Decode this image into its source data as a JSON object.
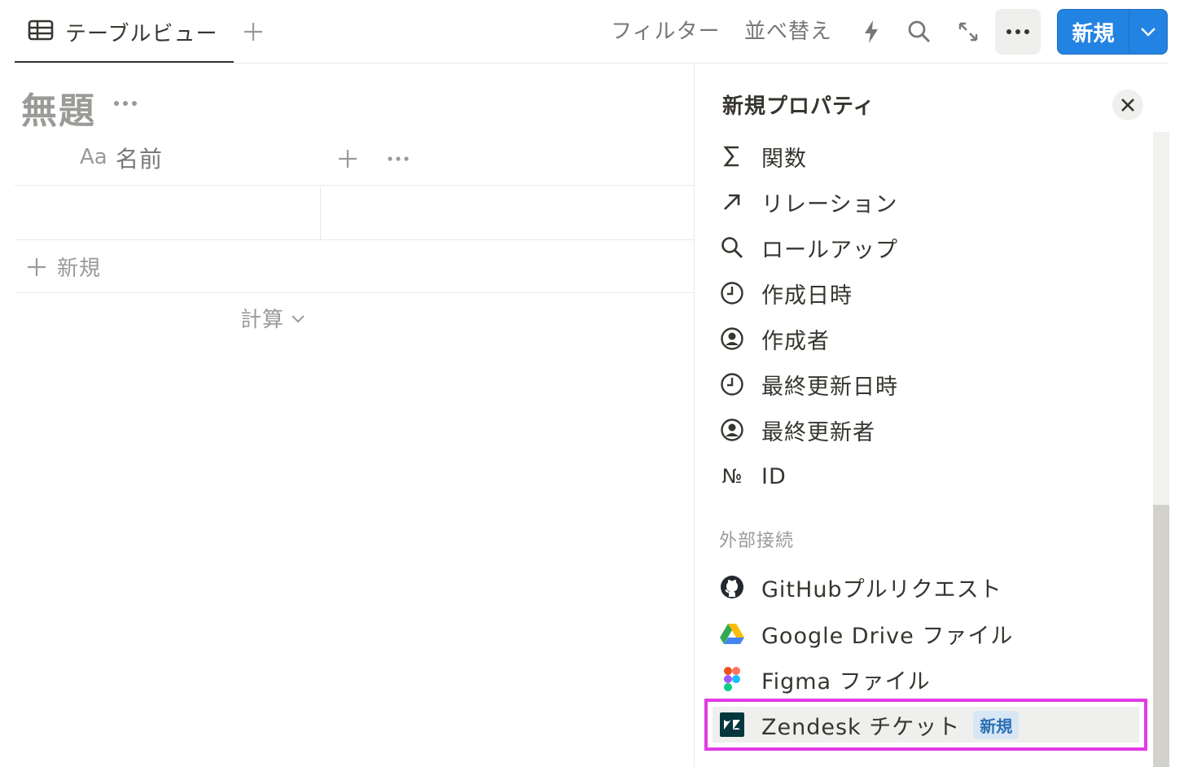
{
  "topbar": {
    "view_tab_label": "テーブルビュー",
    "filter_label": "フィルター",
    "sort_label": "並べ替え",
    "new_button_label": "新規"
  },
  "table": {
    "title": "無題",
    "column_type_glyph": "Aa",
    "column_name": "名前",
    "add_row_label": "新規",
    "calc_label": "計算"
  },
  "panel": {
    "title": "新規プロパティ",
    "items": [
      {
        "label": "関数",
        "icon": "sigma-icon"
      },
      {
        "label": "リレーション",
        "icon": "arrow-up-right-icon"
      },
      {
        "label": "ロールアップ",
        "icon": "search-icon"
      },
      {
        "label": "作成日時",
        "icon": "clock-icon"
      },
      {
        "label": "作成者",
        "icon": "user-circle-icon"
      },
      {
        "label": "最終更新日時",
        "icon": "clock-icon"
      },
      {
        "label": "最終更新者",
        "icon": "user-circle-icon"
      },
      {
        "label": "ID",
        "icon": "numero-icon"
      }
    ],
    "section_label": "外部接続",
    "external": [
      {
        "label": "GitHubプルリクエスト",
        "icon": "github-icon"
      },
      {
        "label": "Google Drive ファイル",
        "icon": "google-drive-icon"
      },
      {
        "label": "Figma ファイル",
        "icon": "figma-icon"
      },
      {
        "label": "Zendesk チケット",
        "icon": "zendesk-icon",
        "badge": "新規"
      }
    ],
    "numero_glyph": "№"
  },
  "colors": {
    "accent": "#2383e2",
    "highlight": "#e33be5",
    "text": "#37352f",
    "muted": "#9b9a97"
  }
}
